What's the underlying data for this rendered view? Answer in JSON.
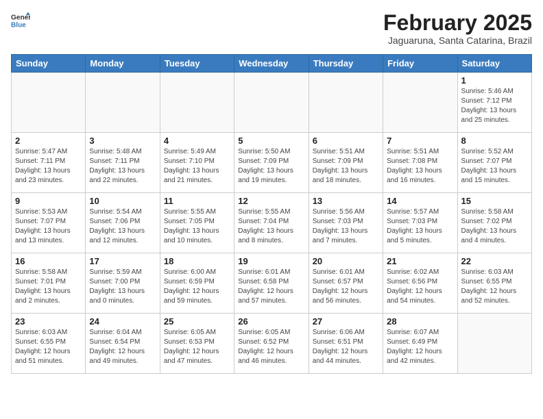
{
  "header": {
    "logo_line1": "General",
    "logo_line2": "Blue",
    "month_title": "February 2025",
    "location": "Jaguaruna, Santa Catarina, Brazil"
  },
  "weekdays": [
    "Sunday",
    "Monday",
    "Tuesday",
    "Wednesday",
    "Thursday",
    "Friday",
    "Saturday"
  ],
  "weeks": [
    [
      {
        "day": "",
        "info": ""
      },
      {
        "day": "",
        "info": ""
      },
      {
        "day": "",
        "info": ""
      },
      {
        "day": "",
        "info": ""
      },
      {
        "day": "",
        "info": ""
      },
      {
        "day": "",
        "info": ""
      },
      {
        "day": "1",
        "info": "Sunrise: 5:46 AM\nSunset: 7:12 PM\nDaylight: 13 hours\nand 25 minutes."
      }
    ],
    [
      {
        "day": "2",
        "info": "Sunrise: 5:47 AM\nSunset: 7:11 PM\nDaylight: 13 hours\nand 23 minutes."
      },
      {
        "day": "3",
        "info": "Sunrise: 5:48 AM\nSunset: 7:11 PM\nDaylight: 13 hours\nand 22 minutes."
      },
      {
        "day": "4",
        "info": "Sunrise: 5:49 AM\nSunset: 7:10 PM\nDaylight: 13 hours\nand 21 minutes."
      },
      {
        "day": "5",
        "info": "Sunrise: 5:50 AM\nSunset: 7:09 PM\nDaylight: 13 hours\nand 19 minutes."
      },
      {
        "day": "6",
        "info": "Sunrise: 5:51 AM\nSunset: 7:09 PM\nDaylight: 13 hours\nand 18 minutes."
      },
      {
        "day": "7",
        "info": "Sunrise: 5:51 AM\nSunset: 7:08 PM\nDaylight: 13 hours\nand 16 minutes."
      },
      {
        "day": "8",
        "info": "Sunrise: 5:52 AM\nSunset: 7:07 PM\nDaylight: 13 hours\nand 15 minutes."
      }
    ],
    [
      {
        "day": "9",
        "info": "Sunrise: 5:53 AM\nSunset: 7:07 PM\nDaylight: 13 hours\nand 13 minutes."
      },
      {
        "day": "10",
        "info": "Sunrise: 5:54 AM\nSunset: 7:06 PM\nDaylight: 13 hours\nand 12 minutes."
      },
      {
        "day": "11",
        "info": "Sunrise: 5:55 AM\nSunset: 7:05 PM\nDaylight: 13 hours\nand 10 minutes."
      },
      {
        "day": "12",
        "info": "Sunrise: 5:55 AM\nSunset: 7:04 PM\nDaylight: 13 hours\nand 8 minutes."
      },
      {
        "day": "13",
        "info": "Sunrise: 5:56 AM\nSunset: 7:03 PM\nDaylight: 13 hours\nand 7 minutes."
      },
      {
        "day": "14",
        "info": "Sunrise: 5:57 AM\nSunset: 7:03 PM\nDaylight: 13 hours\nand 5 minutes."
      },
      {
        "day": "15",
        "info": "Sunrise: 5:58 AM\nSunset: 7:02 PM\nDaylight: 13 hours\nand 4 minutes."
      }
    ],
    [
      {
        "day": "16",
        "info": "Sunrise: 5:58 AM\nSunset: 7:01 PM\nDaylight: 13 hours\nand 2 minutes."
      },
      {
        "day": "17",
        "info": "Sunrise: 5:59 AM\nSunset: 7:00 PM\nDaylight: 13 hours\nand 0 minutes."
      },
      {
        "day": "18",
        "info": "Sunrise: 6:00 AM\nSunset: 6:59 PM\nDaylight: 12 hours\nand 59 minutes."
      },
      {
        "day": "19",
        "info": "Sunrise: 6:01 AM\nSunset: 6:58 PM\nDaylight: 12 hours\nand 57 minutes."
      },
      {
        "day": "20",
        "info": "Sunrise: 6:01 AM\nSunset: 6:57 PM\nDaylight: 12 hours\nand 56 minutes."
      },
      {
        "day": "21",
        "info": "Sunrise: 6:02 AM\nSunset: 6:56 PM\nDaylight: 12 hours\nand 54 minutes."
      },
      {
        "day": "22",
        "info": "Sunrise: 6:03 AM\nSunset: 6:55 PM\nDaylight: 12 hours\nand 52 minutes."
      }
    ],
    [
      {
        "day": "23",
        "info": "Sunrise: 6:03 AM\nSunset: 6:55 PM\nDaylight: 12 hours\nand 51 minutes."
      },
      {
        "day": "24",
        "info": "Sunrise: 6:04 AM\nSunset: 6:54 PM\nDaylight: 12 hours\nand 49 minutes."
      },
      {
        "day": "25",
        "info": "Sunrise: 6:05 AM\nSunset: 6:53 PM\nDaylight: 12 hours\nand 47 minutes."
      },
      {
        "day": "26",
        "info": "Sunrise: 6:05 AM\nSunset: 6:52 PM\nDaylight: 12 hours\nand 46 minutes."
      },
      {
        "day": "27",
        "info": "Sunrise: 6:06 AM\nSunset: 6:51 PM\nDaylight: 12 hours\nand 44 minutes."
      },
      {
        "day": "28",
        "info": "Sunrise: 6:07 AM\nSunset: 6:49 PM\nDaylight: 12 hours\nand 42 minutes."
      },
      {
        "day": "",
        "info": ""
      }
    ]
  ]
}
